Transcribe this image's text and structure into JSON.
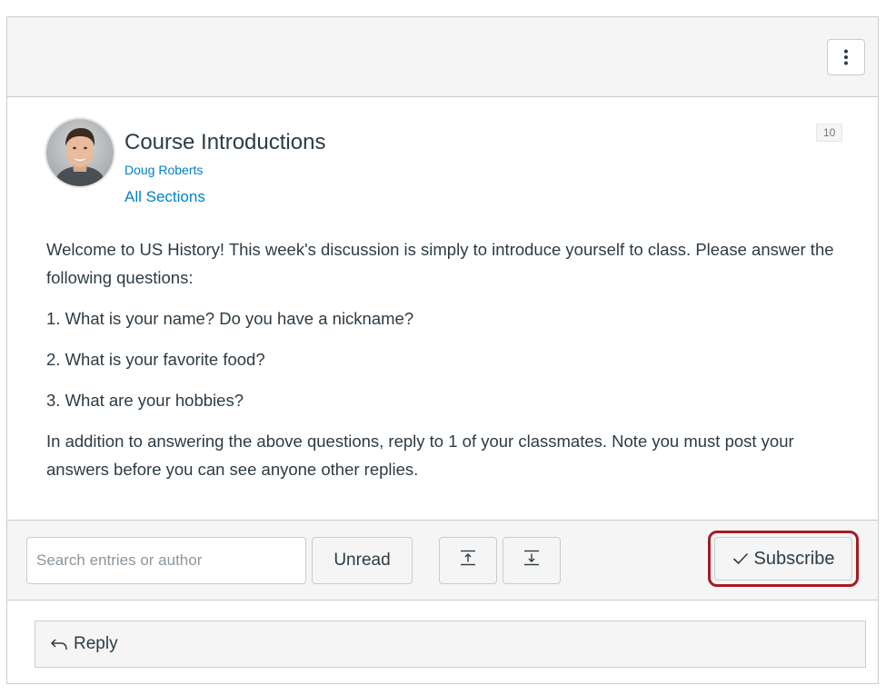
{
  "topic": {
    "title": "Course Introductions",
    "author": "Doug Roberts",
    "sections": "All Sections",
    "reply_count": "10"
  },
  "message": {
    "intro": "Welcome to US History! This week's discussion is simply to introduce yourself to class. Please answer the following questions:",
    "questions": [
      "1. What is your name? Do you have a nickname?",
      "2. What is your favorite food?",
      "3. What are your hobbies?"
    ],
    "closing": "In addition to answering the above questions, reply to 1 of your classmates. Note you must post your answers before you can see anyone other replies."
  },
  "toolbar": {
    "search_placeholder": "Search entries or author",
    "unread_label": "Unread",
    "subscribe_label": "Subscribe"
  },
  "reply": {
    "label": "Reply"
  },
  "icons": {
    "options": "kebab-menu-icon",
    "collapse": "collapse-threads-icon",
    "expand": "expand-threads-icon",
    "check": "check-icon",
    "reply": "reply-arrow-icon"
  },
  "colors": {
    "link": "#0081c8",
    "highlight": "#a61b22",
    "text": "#2d3b45"
  }
}
